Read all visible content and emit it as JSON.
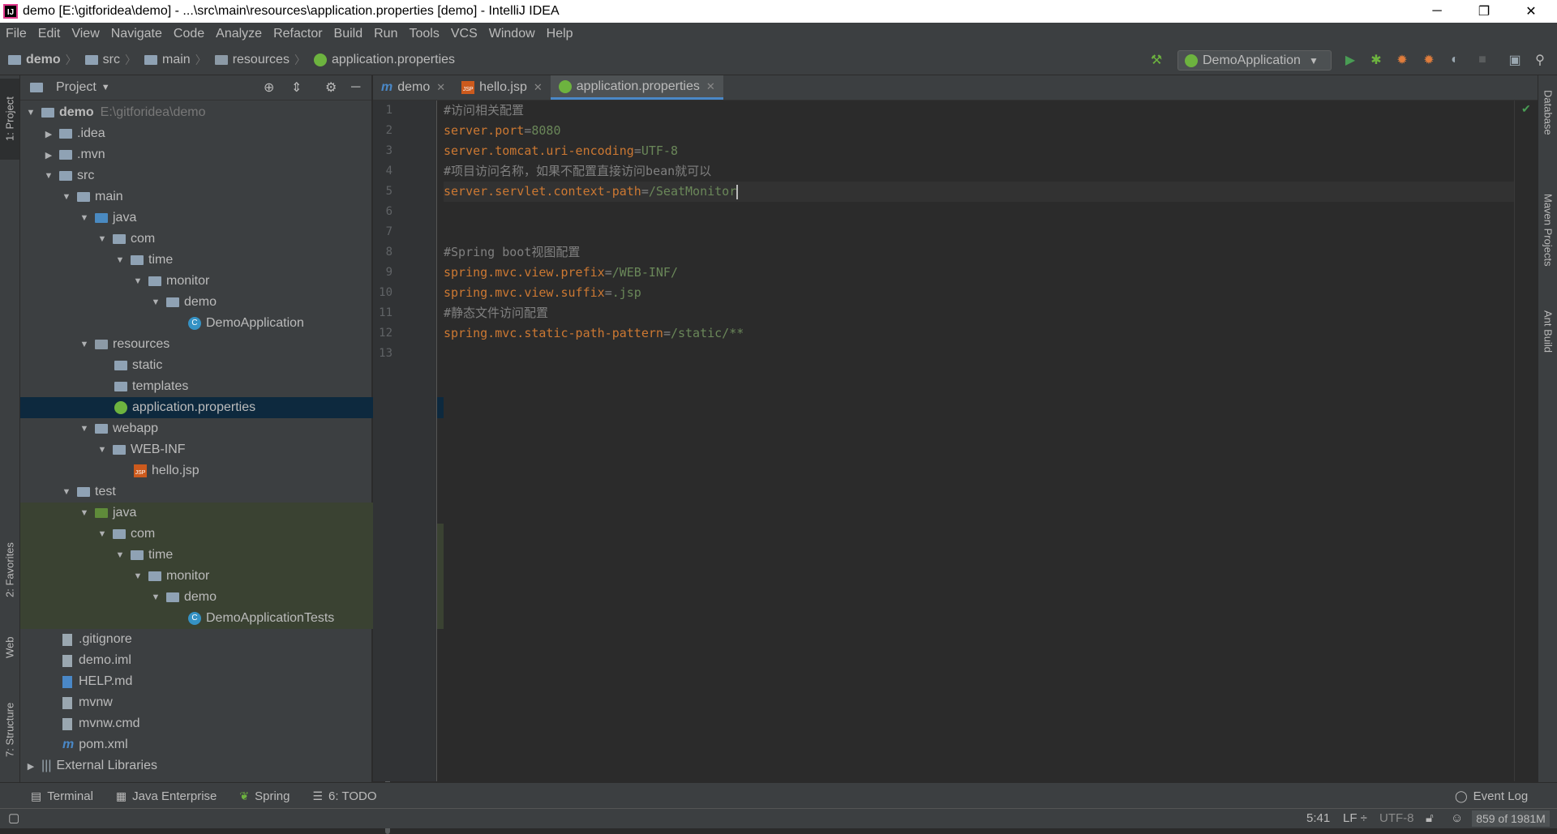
{
  "window": {
    "title": "demo [E:\\gitforidea\\demo] - ...\\src\\main\\resources\\application.properties [demo] - IntelliJ IDEA",
    "app_icon_text": "IJ",
    "minimize": "─",
    "restore": "❐",
    "close": "✕"
  },
  "menu": [
    "File",
    "Edit",
    "View",
    "Navigate",
    "Code",
    "Analyze",
    "Refactor",
    "Build",
    "Run",
    "Tools",
    "VCS",
    "Window",
    "Help"
  ],
  "breadcrumbs": [
    "demo",
    "src",
    "main",
    "resources",
    "application.properties"
  ],
  "toolbar": {
    "run_config": "DemoApplication",
    "icons": [
      "build-hammer-icon",
      "run-icon",
      "debug-icon",
      "coverage-icon",
      "profile-icon",
      "attach-icon",
      "stop-icon",
      "project-structure-icon",
      "search-icon"
    ]
  },
  "left_tool_tabs": {
    "project": "1: Project",
    "favorites": "2: Favorites",
    "web": "Web",
    "structure": "7: Structure"
  },
  "right_tool_tabs": [
    "Database",
    "Maven Projects",
    "Ant Build"
  ],
  "project_panel": {
    "title": "Project",
    "tree": [
      {
        "label": "demo",
        "path": "E:\\gitforidea\\demo"
      },
      {
        "label": ".idea"
      },
      {
        "label": ".mvn"
      },
      {
        "label": "src"
      },
      {
        "label": "main"
      },
      {
        "label": "java"
      },
      {
        "label": "com"
      },
      {
        "label": "time"
      },
      {
        "label": "monitor"
      },
      {
        "label": "demo"
      },
      {
        "label": "DemoApplication"
      },
      {
        "label": "resources"
      },
      {
        "label": "static"
      },
      {
        "label": "templates"
      },
      {
        "label": "application.properties"
      },
      {
        "label": "webapp"
      },
      {
        "label": "WEB-INF"
      },
      {
        "label": "hello.jsp"
      },
      {
        "label": "test"
      },
      {
        "label": "java"
      },
      {
        "label": "com"
      },
      {
        "label": "time"
      },
      {
        "label": "monitor"
      },
      {
        "label": "demo"
      },
      {
        "label": "DemoApplicationTests"
      },
      {
        "label": ".gitignore"
      },
      {
        "label": "demo.iml"
      },
      {
        "label": "HELP.md"
      },
      {
        "label": "mvnw"
      },
      {
        "label": "mvnw.cmd"
      },
      {
        "label": "pom.xml"
      },
      {
        "label": "External Libraries"
      }
    ]
  },
  "editor": {
    "tabs": [
      {
        "label": "demo",
        "active": false
      },
      {
        "label": "hello.jsp",
        "active": false
      },
      {
        "label": "application.properties",
        "active": true
      }
    ],
    "line_numbers": [
      "1",
      "2",
      "3",
      "4",
      "5",
      "6",
      "7",
      "8",
      "9",
      "10",
      "11",
      "12",
      "13"
    ],
    "lines": [
      {
        "type": "comment",
        "text": "#访问相关配置"
      },
      {
        "type": "prop",
        "key": "server.port",
        "value": "8080"
      },
      {
        "type": "prop",
        "key": "server.tomcat.uri-encoding",
        "value": "UTF-8"
      },
      {
        "type": "comment",
        "text": "#项目访问名称，如果不配置直接访问bean就可以"
      },
      {
        "type": "prop",
        "key": "server.servlet.context-path",
        "value": "/SeatMonitor"
      },
      {
        "type": "blank",
        "text": ""
      },
      {
        "type": "blank",
        "text": ""
      },
      {
        "type": "comment",
        "text": "#Spring boot视图配置"
      },
      {
        "type": "prop",
        "key": "spring.mvc.view.prefix",
        "value": "/WEB-INF/"
      },
      {
        "type": "prop",
        "key": "spring.mvc.view.suffix",
        "value": ".jsp"
      },
      {
        "type": "comment",
        "text": "#静态文件访问配置"
      },
      {
        "type": "prop",
        "key": "spring.mvc.static-path-pattern",
        "value": "/static/**"
      },
      {
        "type": "blank",
        "text": ""
      }
    ],
    "eq": "="
  },
  "bottom_tabs": [
    "Terminal",
    "Java Enterprise",
    "Spring",
    "6: TODO"
  ],
  "event_log": "Event Log",
  "status": {
    "position": "5:41",
    "line_sep": "LF ÷",
    "encoding": "UTF-8",
    "memory": "859 of 1981M"
  },
  "colors": {
    "keyword": "#cc7832",
    "value": "#6a8759",
    "comment": "#808080",
    "selection": "#0d293e",
    "accent": "#4a88c7"
  }
}
